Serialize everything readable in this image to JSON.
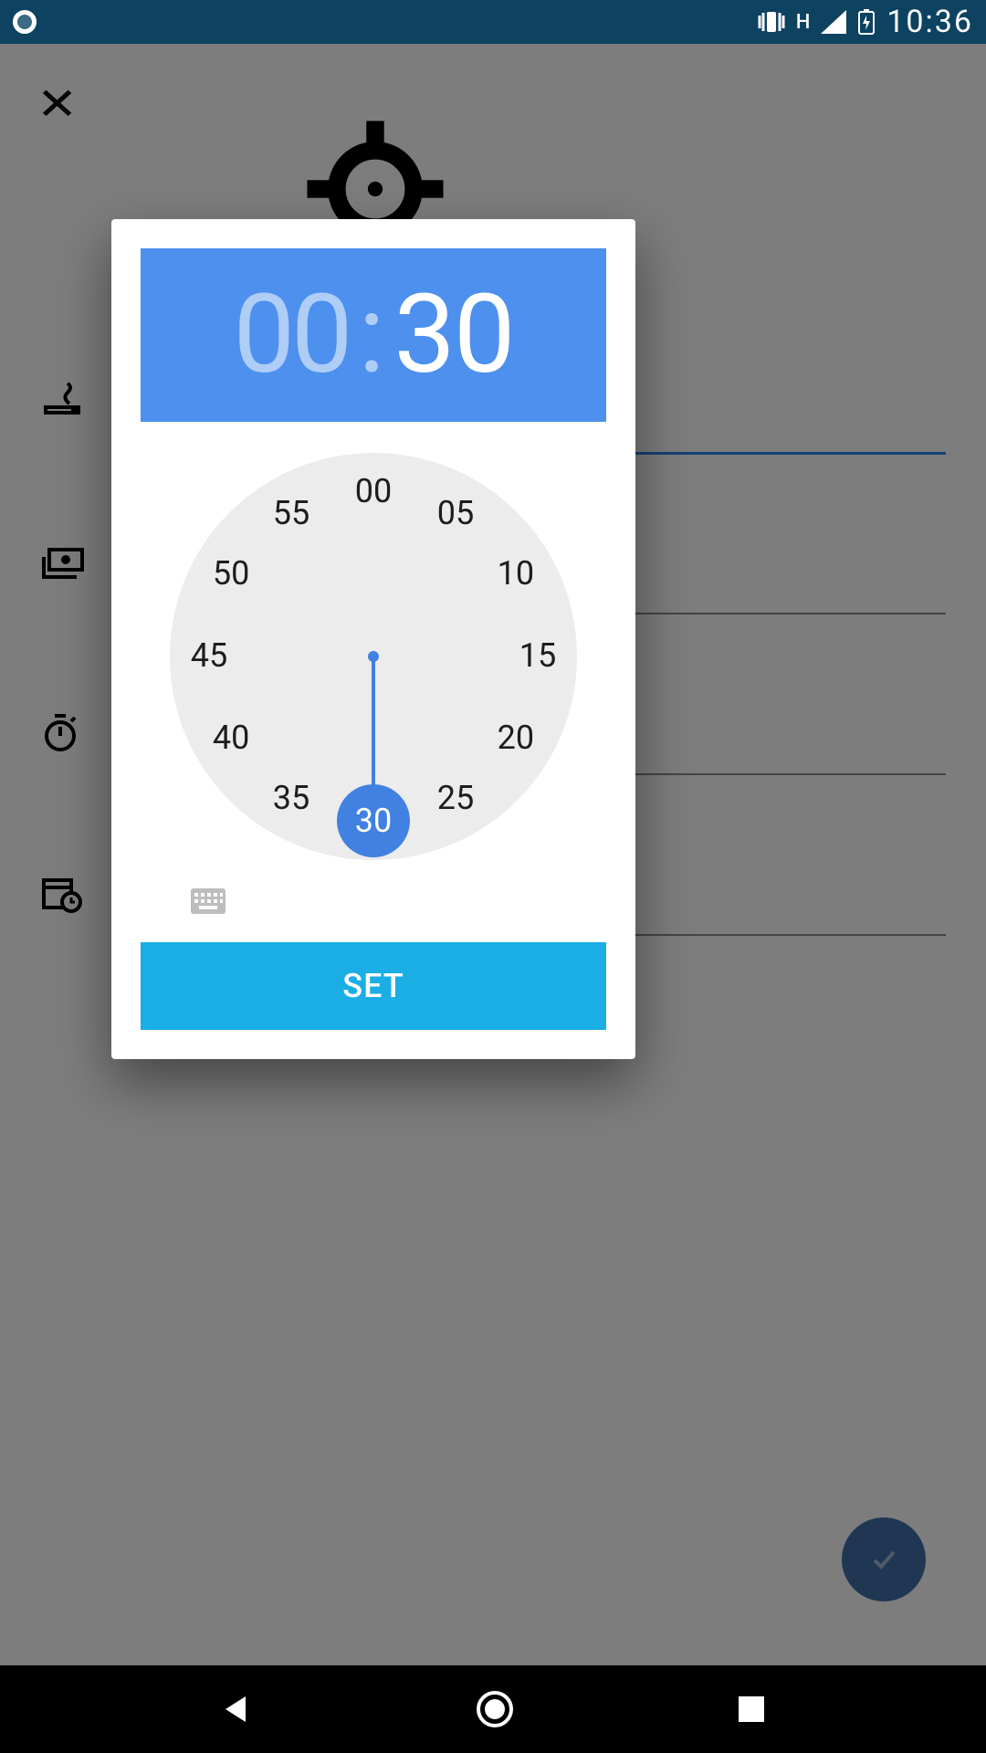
{
  "status_bar": {
    "time": "10:36",
    "network_label": "H"
  },
  "background": {
    "side_icons": [
      "smoking",
      "money",
      "stopwatch",
      "calendar"
    ]
  },
  "dialog": {
    "hours": "00",
    "minutes": "30",
    "set_label": "SET",
    "selected_minute": "30",
    "hand_angle_deg": 0,
    "clock_face": [
      {
        "label": "00",
        "angle": 0
      },
      {
        "label": "05",
        "angle": 30
      },
      {
        "label": "10",
        "angle": 60
      },
      {
        "label": "15",
        "angle": 90
      },
      {
        "label": "20",
        "angle": 120
      },
      {
        "label": "25",
        "angle": 150
      },
      {
        "label": "30",
        "angle": 180
      },
      {
        "label": "35",
        "angle": 210
      },
      {
        "label": "40",
        "angle": 240
      },
      {
        "label": "45",
        "angle": 270
      },
      {
        "label": "50",
        "angle": 300
      },
      {
        "label": "55",
        "angle": 330
      }
    ]
  },
  "colors": {
    "status_bg": "#0d4261",
    "header_blue": "#4d90ee",
    "accent_blue": "#4181e1",
    "set_btn": "#1aaee5",
    "clock_bg": "#ececec",
    "dim": "rgba(0,0,0,0.50)"
  }
}
